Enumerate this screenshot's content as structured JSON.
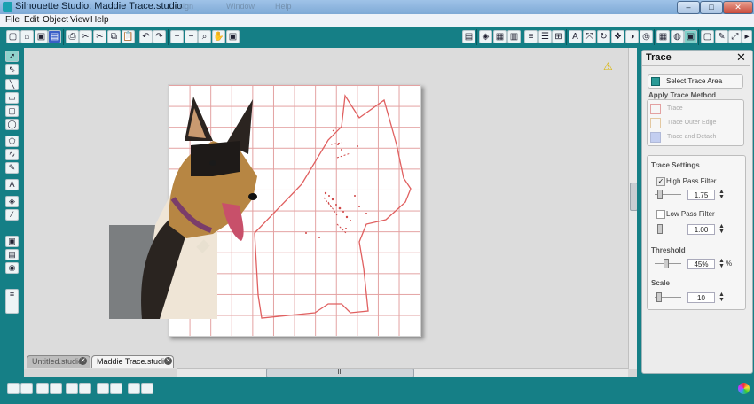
{
  "window": {
    "title": "Silhouette Studio: Maddie Trace.studio"
  },
  "menu": [
    "File",
    "Edit",
    "Object",
    "View",
    "Help"
  ],
  "background_menu": [
    "Design",
    "Window",
    "Help"
  ],
  "tabs": [
    {
      "label": "Untitled.studio",
      "active": false
    },
    {
      "label": "Maddie Trace.studio",
      "active": true
    }
  ],
  "trace_panel": {
    "title": "Trace",
    "select_area_label": "Select Trace Area",
    "apply_method_label": "Apply Trace Method",
    "methods": [
      "Trace",
      "Trace Outer Edge",
      "Trace and Detach"
    ],
    "settings_label": "Trace Settings",
    "high_pass": {
      "label": "High Pass Filter",
      "checked": true,
      "value": "1.75"
    },
    "low_pass": {
      "label": "Low Pass Filter",
      "checked": false,
      "value": "1.00"
    },
    "threshold": {
      "label": "Threshold",
      "value": "45%",
      "unit": "%"
    },
    "scale": {
      "label": "Scale",
      "value": "10"
    }
  },
  "scrollbar": {
    "thumb_label": "III"
  },
  "colors": {
    "teal": "#157f86",
    "trace_red": "#e06060",
    "grid": "#e3a1a1"
  }
}
